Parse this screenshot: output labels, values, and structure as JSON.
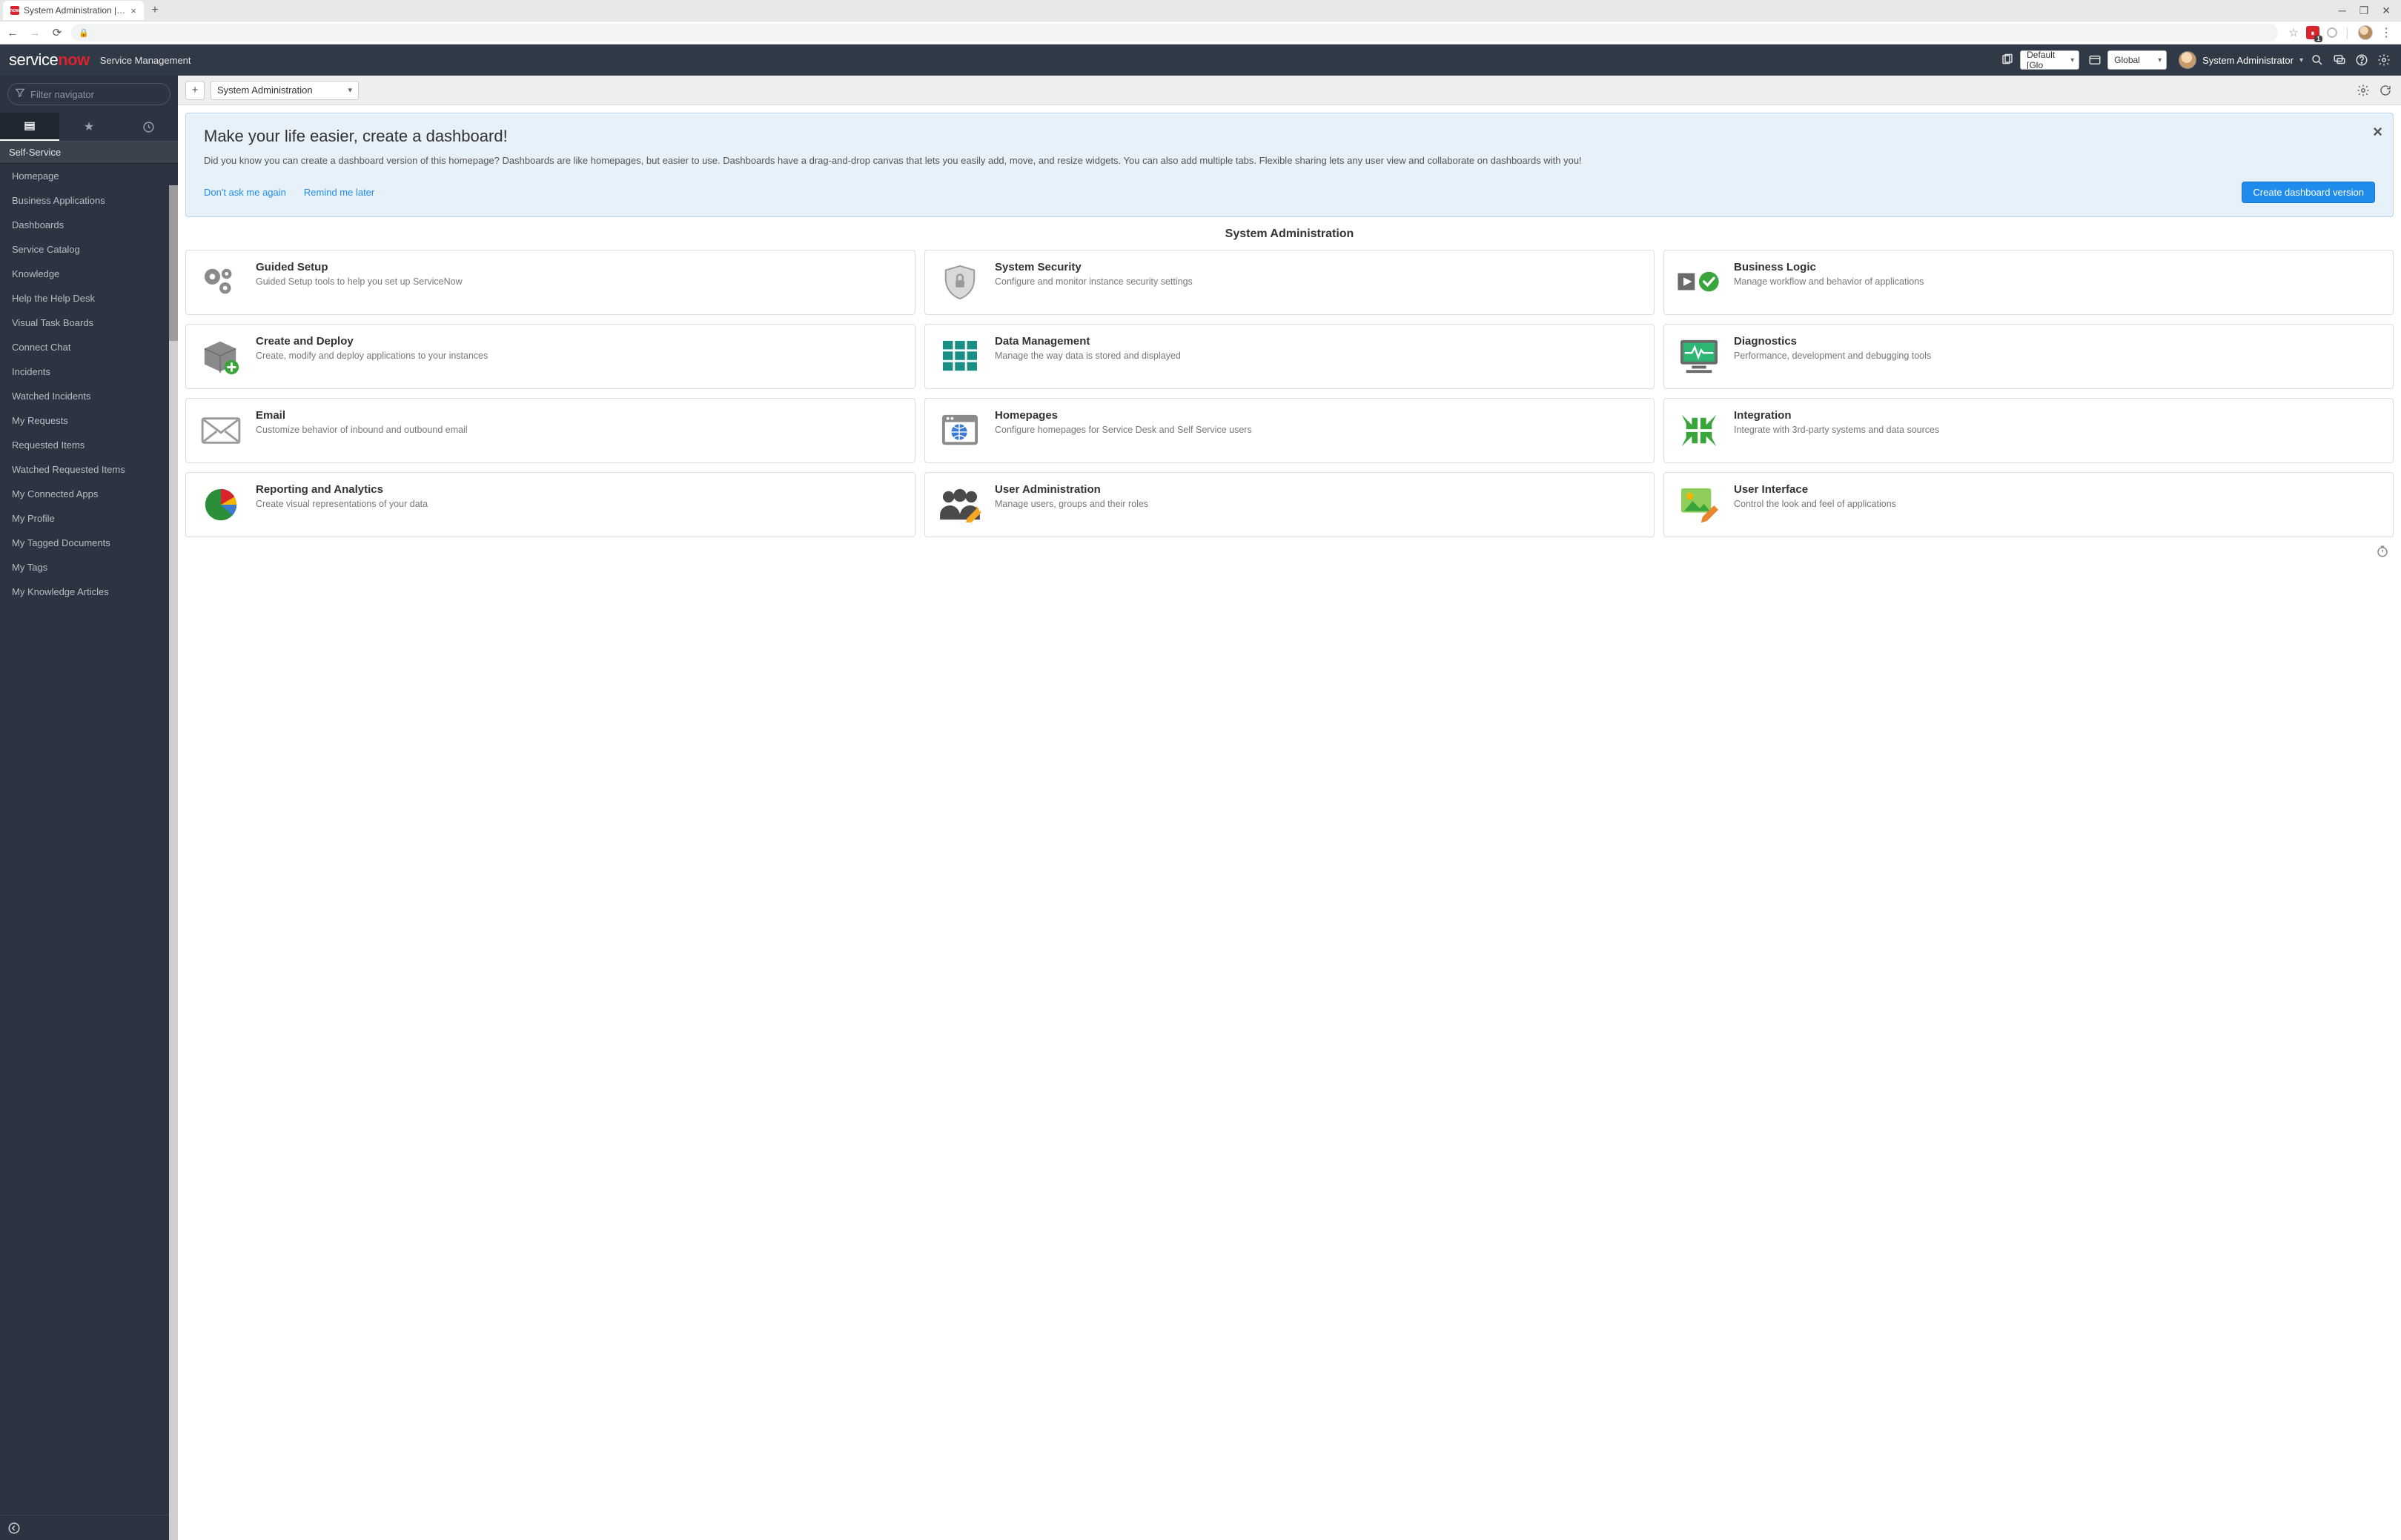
{
  "browser": {
    "tab_title": "System Administration | ServiceN",
    "favicon_text": "now"
  },
  "header": {
    "logo_service": "service",
    "logo_now": "now",
    "product": "Service Management",
    "app_scope_value": "Default [Glo",
    "update_set_value": "Global",
    "user_name": "System Administrator"
  },
  "nav": {
    "filter_placeholder": "Filter navigator",
    "section": "Self-Service",
    "items": [
      "Homepage",
      "Business Applications",
      "Dashboards",
      "Service Catalog",
      "Knowledge",
      "Help the Help Desk",
      "Visual Task Boards",
      "Connect Chat",
      "Incidents",
      "Watched Incidents",
      "My Requests",
      "Requested Items",
      "Watched Requested Items",
      "My Connected Apps",
      "My Profile",
      "My Tagged Documents",
      "My Tags",
      "My Knowledge Articles"
    ]
  },
  "toolbar": {
    "page_name": "System Administration"
  },
  "banner": {
    "title": "Make your life easier, create a dashboard!",
    "text": "Did you know you can create a dashboard version of this homepage? Dashboards are like homepages, but easier to use. Dashboards have a drag-and-drop canvas that lets you easily add, move, and resize widgets. You can also add multiple tabs. Flexible sharing lets any user view and collaborate on dashboards with you!",
    "dont_ask": "Don't ask me again",
    "remind": "Remind me later",
    "create": "Create dashboard version"
  },
  "page_title": "System Administration",
  "cards": [
    {
      "title": "Guided Setup",
      "desc": "Guided Setup tools to help you set up ServiceNow"
    },
    {
      "title": "System Security",
      "desc": "Configure and monitor instance security settings"
    },
    {
      "title": "Business Logic",
      "desc": "Manage workflow and behavior of applications"
    },
    {
      "title": "Create and Deploy",
      "desc": "Create, modify and deploy applications to your instances"
    },
    {
      "title": "Data Management",
      "desc": "Manage the way data is stored and displayed"
    },
    {
      "title": "Diagnostics",
      "desc": "Performance, development and debugging tools"
    },
    {
      "title": "Email",
      "desc": "Customize behavior of inbound and outbound email"
    },
    {
      "title": "Homepages",
      "desc": "Configure homepages for Service Desk and Self Service users"
    },
    {
      "title": "Integration",
      "desc": "Integrate with 3rd-party systems and data sources"
    },
    {
      "title": "Reporting and Analytics",
      "desc": "Create visual representations of your data"
    },
    {
      "title": "User Administration",
      "desc": "Manage users, groups and their roles"
    },
    {
      "title": "User Interface",
      "desc": "Control the look and feel of applications"
    }
  ]
}
